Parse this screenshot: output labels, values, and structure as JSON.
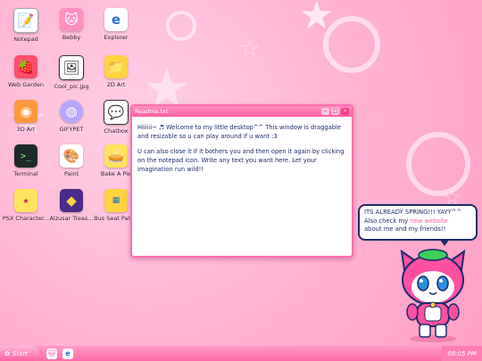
{
  "desktop": {
    "icons": [
      {
        "label": "Notepad",
        "icon": "notepad-icon"
      },
      {
        "label": "Bebby",
        "icon": "cat-icon"
      },
      {
        "label": "Explorer",
        "icon": "internet-explorer-icon"
      },
      {
        "label": "Web Garden",
        "icon": "strawberry-icon"
      },
      {
        "label": "Cool_pic.jpg",
        "icon": "image-icon"
      },
      {
        "label": "2D Art",
        "icon": "folder-icon"
      },
      {
        "label": "3D Art",
        "icon": "blender-icon"
      },
      {
        "label": "GIFYPET",
        "icon": "tamagotchi-icon"
      },
      {
        "label": "Chatbox",
        "icon": "chat-icon"
      },
      {
        "label": "Terminal",
        "icon": "terminal-icon"
      },
      {
        "label": "Paint",
        "icon": "palette-icon"
      },
      {
        "label": "Bake A Pie",
        "icon": "pie-icon"
      },
      {
        "label": "PSX Character...",
        "icon": "game-icon"
      },
      {
        "label": "Alzusar Treas...",
        "icon": "pixel-game-icon"
      },
      {
        "label": "Bus Seat Patt...",
        "icon": "bus-seat-icon"
      }
    ]
  },
  "window": {
    "title": "Readme.txt",
    "min_glyph": "–",
    "max_glyph": "□",
    "close_glyph": "×",
    "paragraph1": "Hiiiiii~ ♬ Welcome to my little desktop^^ This window is draggable and resizable so u can play around if u want :3",
    "paragraph2": "U can also close it if it bothers you and then open it again by clicking on the notepad icon. Write any text you want here. Let your imagination run wild!!"
  },
  "bubble": {
    "line1": "ITS ALREADY SPRING!!! YAYY^^",
    "pre": "Also check my ",
    "link": "new website",
    "post": "about me and my friends!!"
  },
  "taskbar": {
    "start_label": "Start",
    "time": "09:05 PM"
  },
  "colors": {
    "accent": "#ff5fa3",
    "text": "#1d2b6b"
  }
}
